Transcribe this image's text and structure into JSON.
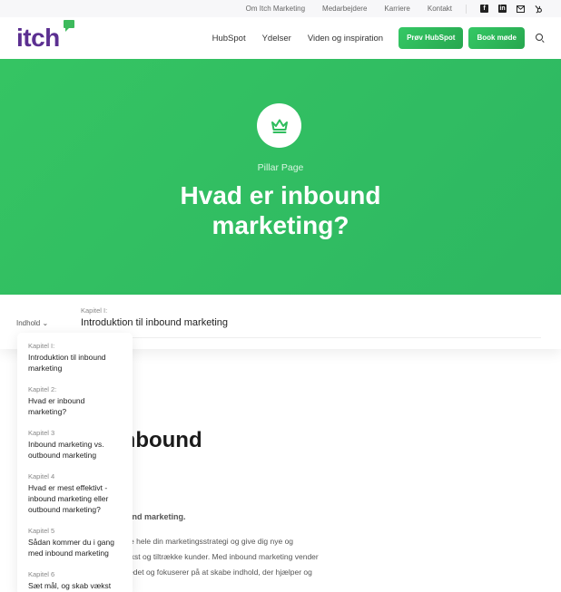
{
  "topbar": {
    "links": [
      "Om Itch Marketing",
      "Medarbejdere",
      "Karriere",
      "Kontakt"
    ],
    "social_icons": [
      "facebook-icon",
      "linkedin-icon",
      "mail-icon",
      "hubspot-icon"
    ]
  },
  "navbar": {
    "logo_text": "itch",
    "links": [
      "HubSpot",
      "Ydelser",
      "Viden og inspiration"
    ],
    "cta_primary": "Prøv HubSpot",
    "cta_secondary": "Book møde",
    "search_icon": "search-icon"
  },
  "hero": {
    "icon": "crown-icon",
    "kicker": "Pillar Page",
    "title": "Hvad er inbound marketing?",
    "colors": {
      "gradient_start": "#35c463",
      "gradient_end": "#2db761"
    }
  },
  "chapter_bar": {
    "toc_toggle": "Indhold ⌄",
    "kicker": "Kapitel I:",
    "title": "Introduktion til inbound marketing"
  },
  "toc": [
    {
      "kicker": "Kapitel I:",
      "title": "Introduktion til inbound marketing"
    },
    {
      "kicker": "Kapitel 2:",
      "title": "Hvad er inbound marketing?"
    },
    {
      "kicker": "Kapitel 3",
      "title": "Inbound marketing vs. outbound marketing"
    },
    {
      "kicker": "Kapitel 4",
      "title": "Hvad er mest effektivt - inbound marketing eller outbound marketing?"
    },
    {
      "kicker": "Kapitel 5",
      "title": "Sådan kommer du i gang med inbound marketing"
    },
    {
      "kicker": "Kapitel 6",
      "title": "Sæt mål, og skab vækst"
    }
  ],
  "content": {
    "title_visible": "til inbound",
    "lead_visible": "med inbound marketing.",
    "body_lines": [
      "at redefinere hele din marketingsstrategi og give dig nye og",
      "n skaffe vækst og tiltrække kunder. Med inbound marketing vender",
      "ang på hovedet og fokuserer på at skabe indhold, der hjælper og"
    ]
  },
  "brand_colors": {
    "purple": "#5b2f91",
    "green": "#2fbd5e"
  }
}
